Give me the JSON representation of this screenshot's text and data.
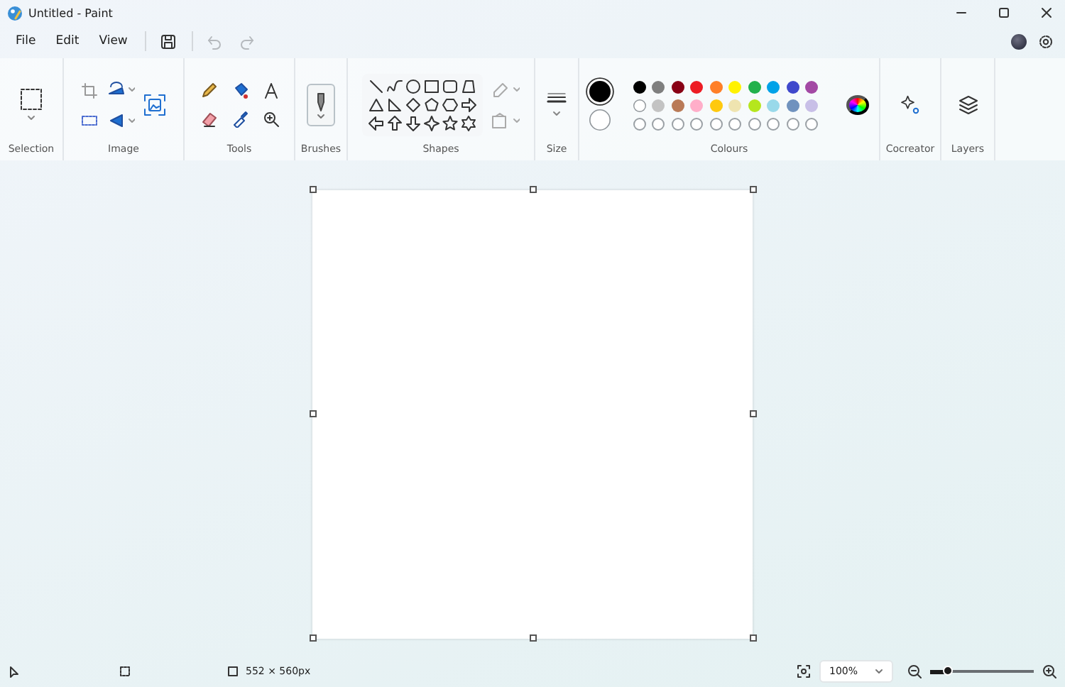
{
  "window": {
    "title": "Untitled - Paint"
  },
  "menu": [
    {
      "label": "File"
    },
    {
      "label": "Edit"
    },
    {
      "label": "View"
    }
  ],
  "quick_actions": [
    {
      "kind": "save",
      "disabled": false
    },
    {
      "kind": "undo",
      "disabled": true
    },
    {
      "kind": "redo",
      "disabled": true
    }
  ],
  "ribbon": [
    {
      "kind": "selection",
      "label": "Selection"
    },
    {
      "kind": "image",
      "label": "Image"
    },
    {
      "kind": "tools",
      "label": "Tools"
    },
    {
      "kind": "brushes",
      "label": "Brushes"
    },
    {
      "kind": "shapes",
      "label": "Shapes"
    },
    {
      "kind": "size",
      "label": "Size"
    },
    {
      "kind": "colours",
      "label": "Colours"
    },
    {
      "kind": "cocreator",
      "label": "Cocreator"
    },
    {
      "kind": "layers",
      "label": "Layers"
    }
  ],
  "colours": {
    "current": [
      {
        "color": "#000000",
        "selected": true
      },
      {
        "color": "#ffffff",
        "selected": false
      }
    ],
    "palette": [
      {
        "color": "#000000"
      },
      {
        "color": "#7f7f7f"
      },
      {
        "color": "#880015"
      },
      {
        "color": "#ed1c24"
      },
      {
        "color": "#ff7f27"
      },
      {
        "color": "#fff200"
      },
      {
        "color": "#22b14c"
      },
      {
        "color": "#00a2e8"
      },
      {
        "color": "#3f48cc"
      },
      {
        "color": "#a349a4"
      },
      {
        "color": "#ffffff"
      },
      {
        "color": "#c3c3c3"
      },
      {
        "color": "#b97a57"
      },
      {
        "color": "#ffaec9"
      },
      {
        "color": "#ffc90e"
      },
      {
        "color": "#efe4b0"
      },
      {
        "color": "#b5e61d"
      },
      {
        "color": "#99d9ea"
      },
      {
        "color": "#7092be"
      },
      {
        "color": "#c8bfe7"
      }
    ],
    "custom_slots": [
      {
        "empty": true
      },
      {
        "empty": true
      },
      {
        "empty": true
      },
      {
        "empty": true
      },
      {
        "empty": true
      },
      {
        "empty": true
      },
      {
        "empty": true
      },
      {
        "empty": true
      },
      {
        "empty": true
      },
      {
        "empty": true
      }
    ]
  },
  "status_bar": {
    "canvas_size": "552 × 560px",
    "zoom": "100%",
    "zoom_slider": {
      "level": 0.17
    }
  }
}
